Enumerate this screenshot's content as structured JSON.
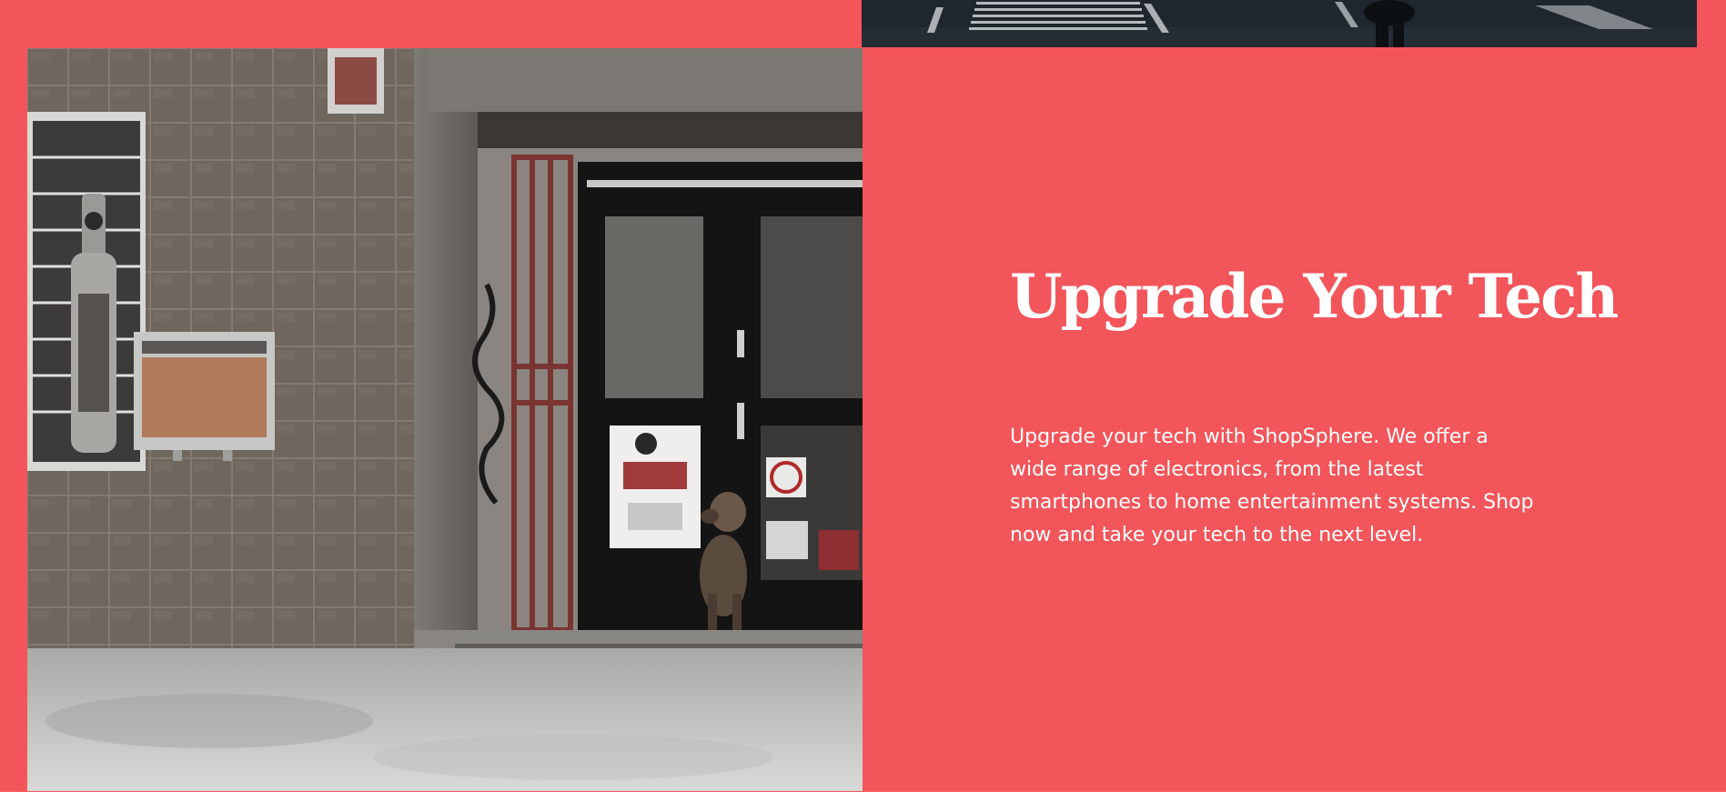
{
  "hero": {
    "title": "Upgrade Your Tech",
    "description": "Upgrade your tech with ShopSphere. We offer a wide range of electronics, from the latest smartphones to home entertainment systems. Shop now and take your tech to the next level."
  },
  "colors": {
    "accent": "#f2555a",
    "text": "#ffffff"
  },
  "images": {
    "storefront_photo": "storefront-photo",
    "street_photo": "street-crosswalk-photo"
  }
}
